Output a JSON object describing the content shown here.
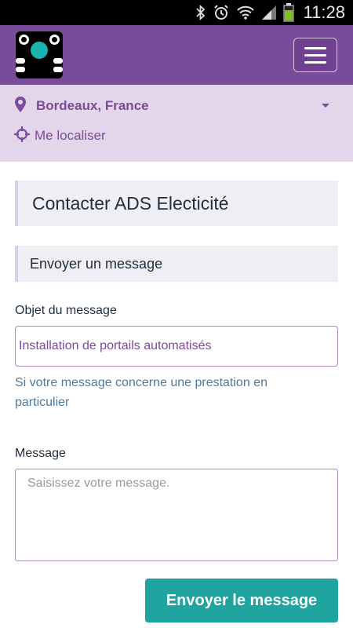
{
  "statusbar": {
    "time": "11:28",
    "icons": [
      "bluetooth-icon",
      "alarm-icon",
      "wifi-icon",
      "signal-icon",
      "battery-icon"
    ]
  },
  "header": {
    "logo": "ADS logo",
    "menu_icon": "hamburger-icon",
    "brand_color": "#7a4b98"
  },
  "location": {
    "city": "Bordeaux, France",
    "locate_label": "Me localiser",
    "pin_icon": "map-pin-icon",
    "locate_icon": "crosshair-icon"
  },
  "main": {
    "title": "Contacter ADS Electicité",
    "section_title": "Envoyer un message",
    "subject_label": "Objet du message",
    "subject_value": "Installation de portails automatisés",
    "hint": "Si votre message concerne une prestation en particulier",
    "message_label": "Message",
    "message_placeholder": "Saisissez votre message.",
    "send_label": "Envoyer le message",
    "accent_color": "#1fa4a0"
  }
}
